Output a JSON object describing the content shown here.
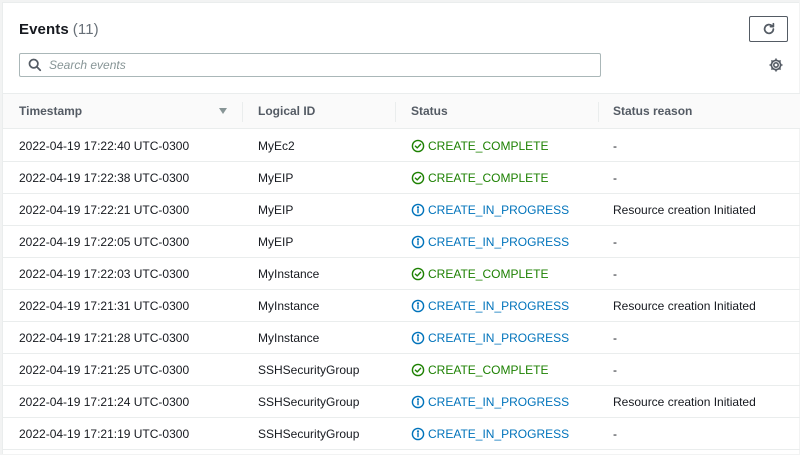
{
  "header": {
    "title": "Events",
    "count": "(11)"
  },
  "search": {
    "placeholder": "Search events",
    "value": ""
  },
  "icons": {
    "refresh": "refresh-icon",
    "search": "search-icon",
    "settings": "gear-icon",
    "sort": "caret-down-icon"
  },
  "colors": {
    "complete": "#1d8102",
    "in_progress": "#0073bb",
    "header_text": "#545b64",
    "border": "#eaeded"
  },
  "table": {
    "columns": [
      "Timestamp",
      "Logical ID",
      "Status",
      "Status reason"
    ],
    "rows": [
      {
        "timestamp": "2022-04-19 17:22:40 UTC-0300",
        "logical_id": "MyEc2",
        "status": "CREATE_COMPLETE",
        "status_type": "complete",
        "reason": "-"
      },
      {
        "timestamp": "2022-04-19 17:22:38 UTC-0300",
        "logical_id": "MyEIP",
        "status": "CREATE_COMPLETE",
        "status_type": "complete",
        "reason": "-"
      },
      {
        "timestamp": "2022-04-19 17:22:21 UTC-0300",
        "logical_id": "MyEIP",
        "status": "CREATE_IN_PROGRESS",
        "status_type": "progress",
        "reason": "Resource creation Initiated"
      },
      {
        "timestamp": "2022-04-19 17:22:05 UTC-0300",
        "logical_id": "MyEIP",
        "status": "CREATE_IN_PROGRESS",
        "status_type": "progress",
        "reason": "-"
      },
      {
        "timestamp": "2022-04-19 17:22:03 UTC-0300",
        "logical_id": "MyInstance",
        "status": "CREATE_COMPLETE",
        "status_type": "complete",
        "reason": "-"
      },
      {
        "timestamp": "2022-04-19 17:21:31 UTC-0300",
        "logical_id": "MyInstance",
        "status": "CREATE_IN_PROGRESS",
        "status_type": "progress",
        "reason": "Resource creation Initiated"
      },
      {
        "timestamp": "2022-04-19 17:21:28 UTC-0300",
        "logical_id": "MyInstance",
        "status": "CREATE_IN_PROGRESS",
        "status_type": "progress",
        "reason": "-"
      },
      {
        "timestamp": "2022-04-19 17:21:25 UTC-0300",
        "logical_id": "SSHSecurityGroup",
        "status": "CREATE_COMPLETE",
        "status_type": "complete",
        "reason": "-"
      },
      {
        "timestamp": "2022-04-19 17:21:24 UTC-0300",
        "logical_id": "SSHSecurityGroup",
        "status": "CREATE_IN_PROGRESS",
        "status_type": "progress",
        "reason": "Resource creation Initiated"
      },
      {
        "timestamp": "2022-04-19 17:21:19 UTC-0300",
        "logical_id": "SSHSecurityGroup",
        "status": "CREATE_IN_PROGRESS",
        "status_type": "progress",
        "reason": "-"
      }
    ]
  }
}
